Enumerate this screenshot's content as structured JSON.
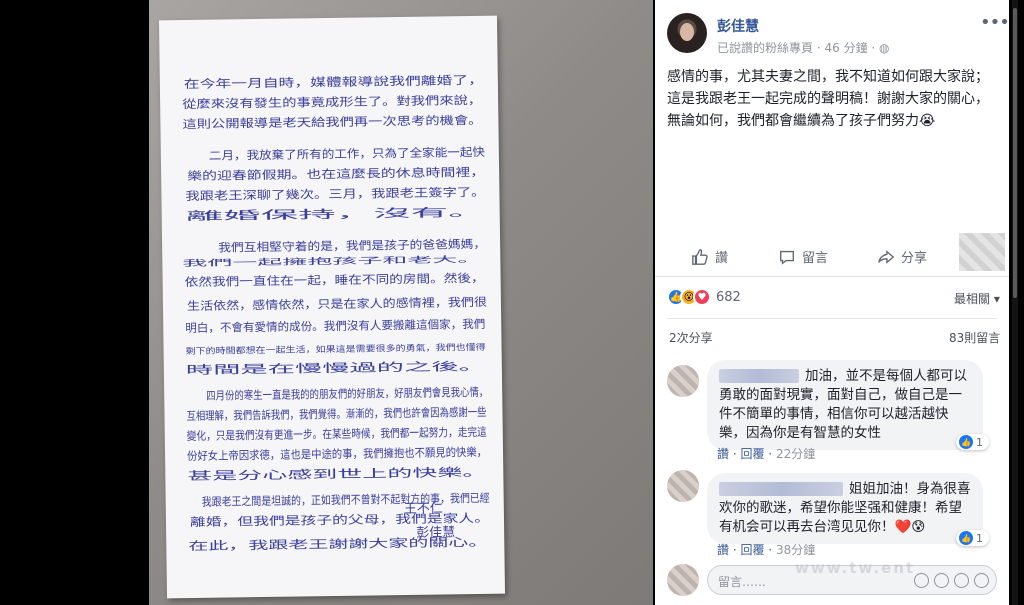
{
  "post": {
    "author": "彭佳慧",
    "meta_prefix": "已說讚的粉絲專頁",
    "time": "46 分鐘",
    "text": "感情的事，尤其夫妻之間，我不知道如何跟大家說；這是我跟老王一起完成的聲明稿！謝謝大家的關心，無論如何，我們都會繼續為了孩子們努力😭"
  },
  "actions": {
    "like": "讚",
    "comment": "留言",
    "share": "分享"
  },
  "reactions": {
    "count": "682",
    "sort": "最相關",
    "shares": "2次分享",
    "comments": "83則留言"
  },
  "comments": [
    {
      "text": "加油，並不是每個人都可以勇敢的面對現實，面對自己，做自己是一件不簡單的事情，相信你可以越活越快樂，因為你是有智慧的女性",
      "likes": "1",
      "like": "讚",
      "reply": "回覆",
      "time": "22分鐘"
    },
    {
      "text": "姐姐加油！身為很喜欢你的歌迷，希望你能坚强和健康！希望有机会可以再去台湾见见你！❤️😰",
      "likes": "1",
      "like": "讚",
      "reply": "回覆",
      "time": "38分鐘"
    }
  ],
  "compose": {
    "placeholder": "留言……"
  },
  "letter": {
    "lines": [
      "在今年一月自時，媒體報導說我們離婚了，",
      "從麼來沒有發生的事竟成形生了。對我們來說，",
      "這則公開報導是老天給我們再一次思考的機會。",
      "二月，我放棄了所有的工作，只為了全家能一起快",
      "樂的迎春節假期。也在這麼長的休息時間裡，",
      "我跟老王深聊了幾次。三月，我跟老王簽字了。",
      "離婚保持，沒有。",
      "我們互相堅守着的是，我們是孩子的爸爸媽媽，",
      "我們一起擁抱孩子和老大。",
      "依然我們一直住在一起，睡在不同的房間。然後，",
      "生活依然，感情依然，只是在家人的感情裡，我們很",
      "明白，不會有愛情的成份。我們沒有人要搬離這個家，我們",
      "剩下的時間都想在一起生活，如果這是需要很多的勇氣，我們也懂得",
      "時間是在慢慢過的之後。",
      "四月份的寒生一直是我的的朋友們的好朋友，好朋友們會見我心情，",
      "互相理解，我們告訴我們，我們覺得。漸漸的，我們也許會因為感謝一些",
      "變化，只是我們沒有更進一步。在某些時候，我們都一起努力，走完這",
      "份好女上帝因求德，這也是中途的事，我們擁抱也不願見的快樂，",
      "甚是分心感到世上的快樂。",
      "我跟老王之間是坦誠的，正如我們不曾對不起對方的事，我們已經",
      "離婚，但我們是孩子的父母，我們是家人。",
      "在此，我跟老王謝謝大家的關心。"
    ],
    "sign1": "王不仁",
    "sign2": "彭佳慧"
  },
  "watermark": "www.tw.ent"
}
